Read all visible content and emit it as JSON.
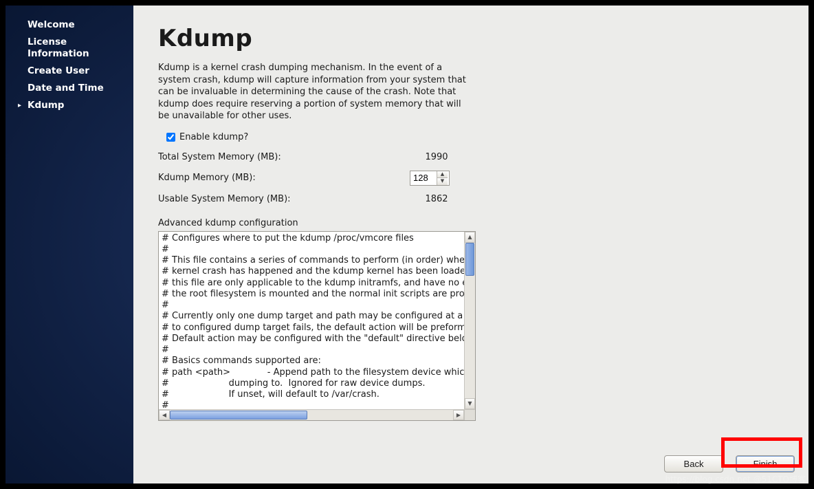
{
  "sidebar": {
    "items": [
      {
        "label": "Welcome",
        "active": false
      },
      {
        "label": "License Information",
        "active": false
      },
      {
        "label": "Create User",
        "active": false
      },
      {
        "label": "Date and Time",
        "active": false
      },
      {
        "label": "Kdump",
        "active": true
      }
    ]
  },
  "page": {
    "title": "Kdump",
    "intro": "Kdump is a kernel crash dumping mechanism. In the event of a system crash, kdump will capture information from your system that can be invaluable in determining the cause of the crash. Note that kdump does require reserving a portion of system memory that will be unavailable for other uses."
  },
  "form": {
    "enable_label": "Enable kdump?",
    "enable_checked": true,
    "total_label": "Total System Memory (MB):",
    "total_value": "1990",
    "kdump_label": "Kdump Memory (MB):",
    "kdump_value": "128",
    "usable_label": "Usable System Memory (MB):",
    "usable_value": "1862",
    "advanced_label": "Advanced kdump configuration",
    "advanced_text": "# Configures where to put the kdump /proc/vmcore files\n#\n# This file contains a series of commands to perform (in order) when a\n# kernel crash has happened and the kdump kernel has been loaded.  Di\n# this file are only applicable to the kdump initramfs, and have no effect\n# the root filesystem is mounted and the normal init scripts are proces\n#\n# Currently only one dump target and path may be configured at a time\n# to configured dump target fails, the default action will be preformed.\n# Default action may be configured with the \"default\" directive below.\n#\n# Basics commands supported are:\n# path <path>             - Append path to the filesystem device which y\n#                     dumping to.  Ignored for raw device dumps.\n#                     If unset, will default to /var/crash.\n#\n# core_collector <command> <options>"
  },
  "footer": {
    "back_label": "Back",
    "finish_label": "Finish"
  },
  "watermark": "https://blog.csdn.net @51CTO博客"
}
